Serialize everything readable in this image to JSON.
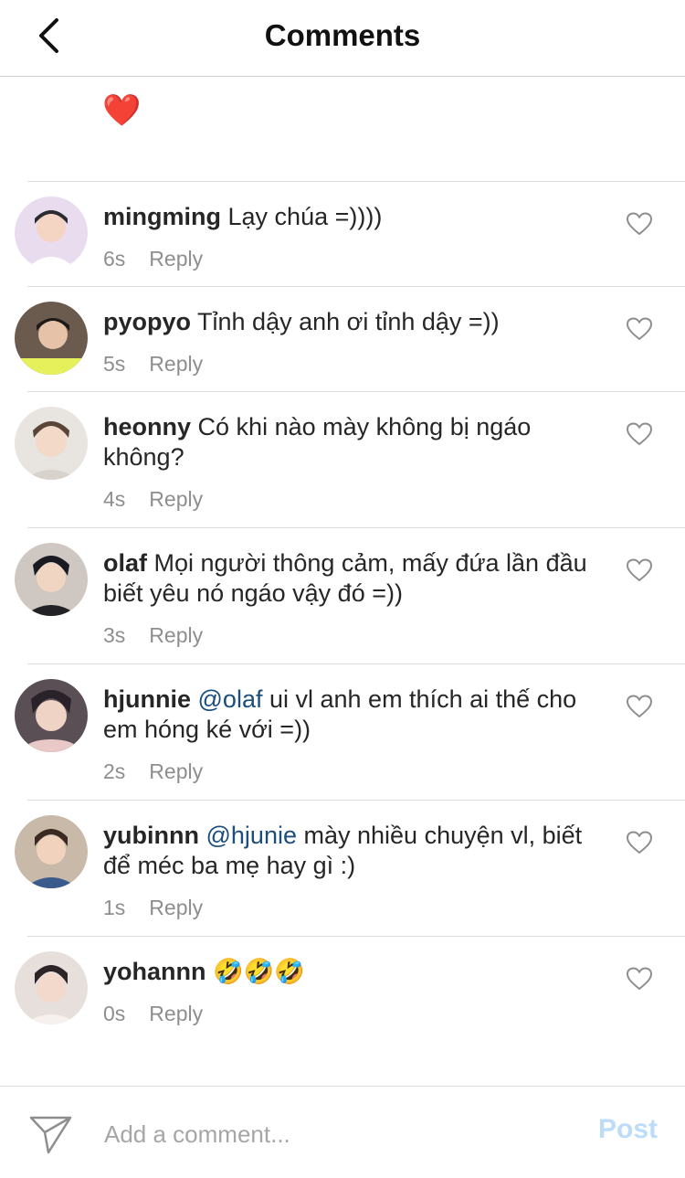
{
  "header": {
    "title": "Comments",
    "back_icon": "chevron-left-icon"
  },
  "caption": {
    "emoji": "❤️"
  },
  "comments": [
    {
      "username": "mingming",
      "mention": "",
      "text": "Lạy chúa =))))",
      "time": "6s",
      "reply": "Reply",
      "avatar_bg": "#e9dcef"
    },
    {
      "username": "pyopyo",
      "mention": "",
      "text": "Tỉnh dậy anh ơi tỉnh dậy =))",
      "time": "5s",
      "reply": "Reply",
      "avatar_bg": "#6b5a4e"
    },
    {
      "username": "heonny",
      "mention": "",
      "text": "Có khi nào mày không bị ngáo không?",
      "time": "4s",
      "reply": "Reply",
      "avatar_bg": "#e8e4df"
    },
    {
      "username": "olaf",
      "mention": "",
      "text": "Mọi người thông cảm, mấy đứa lần đầu biết yêu nó ngáo vậy đó =))",
      "time": "3s",
      "reply": "Reply",
      "avatar_bg": "#cfc7c2"
    },
    {
      "username": "hjunnie",
      "mention": "@olaf",
      "text": "ui vl anh em thích ai thế cho em hóng ké với =))",
      "time": "2s",
      "reply": "Reply",
      "avatar_bg": "#5a4f55"
    },
    {
      "username": "yubinnn",
      "mention": "@hjunie",
      "text": "mày nhiều chuyện vl, biết để méc ba mẹ hay gì :)",
      "time": "1s",
      "reply": "Reply",
      "avatar_bg": "#c9b9a8"
    },
    {
      "username": "yohannn",
      "mention": "",
      "text": "🤣🤣🤣",
      "time": "0s",
      "reply": "Reply",
      "avatar_bg": "#e7dfdc"
    }
  ],
  "footer": {
    "placeholder": "Add a comment...",
    "post_label": "Post",
    "send_icon": "paper-plane-icon"
  },
  "colors": {
    "mention": "#1b4d7e",
    "meta": "#8e8e8e",
    "post_disabled": "#bcdcfa"
  }
}
